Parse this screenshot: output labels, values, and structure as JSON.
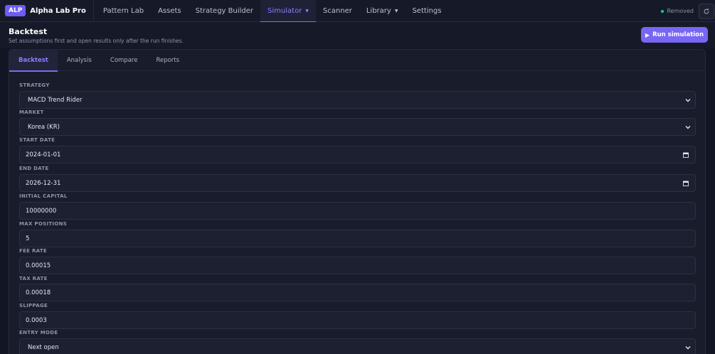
{
  "nav": {
    "brand_badge": "ALP",
    "brand_name": "Alpha Lab Pro",
    "items": [
      {
        "label": "Pattern Lab",
        "caret": false,
        "active": false
      },
      {
        "label": "Assets",
        "caret": false,
        "active": false
      },
      {
        "label": "Strategy Builder",
        "caret": false,
        "active": false
      },
      {
        "label": "Simulator",
        "caret": true,
        "active": true
      },
      {
        "label": "Scanner",
        "caret": false,
        "active": false
      },
      {
        "label": "Library",
        "caret": true,
        "active": false
      },
      {
        "label": "Settings",
        "caret": false,
        "active": false
      }
    ],
    "status_text": "Removed",
    "status_color": "#22c3a6",
    "refresh_icon": "refresh-icon"
  },
  "header": {
    "title": "Backtest",
    "subtitle": "Set assumptions first and open results only after the run finishes.",
    "run_button": "Run simulation",
    "run_icon": "play-icon",
    "accent": "#7866f5"
  },
  "tabs": [
    {
      "label": "Backtest",
      "active": true
    },
    {
      "label": "Analysis",
      "active": false
    },
    {
      "label": "Compare",
      "active": false
    },
    {
      "label": "Reports",
      "active": false
    }
  ],
  "form": {
    "strategy": {
      "label": "STRATEGY",
      "value": "MACD Trend Rider"
    },
    "market": {
      "label": "MARKET",
      "value": "Korea (KR)"
    },
    "start_date": {
      "label": "START DATE",
      "value": "2024-01-01"
    },
    "end_date": {
      "label": "END DATE",
      "value": "2026-12-31"
    },
    "initial_capital": {
      "label": "INITIAL CAPITAL",
      "value": "10000000"
    },
    "max_positions": {
      "label": "MAX POSITIONS",
      "value": "5"
    },
    "fee_rate": {
      "label": "FEE RATE",
      "value": "0.00015"
    },
    "tax_rate": {
      "label": "TAX RATE",
      "value": "0.00018"
    },
    "slippage": {
      "label": "SLIPPAGE",
      "value": "0.0003"
    },
    "entry_mode": {
      "label": "ENTRY MODE",
      "value": "Next open"
    }
  }
}
